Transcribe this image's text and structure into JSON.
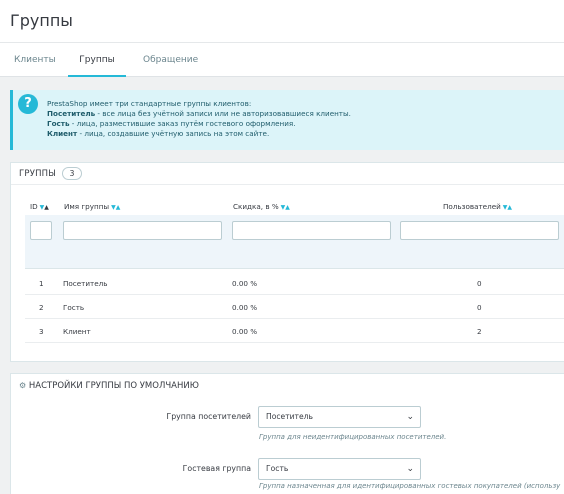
{
  "page": {
    "title": "Группы"
  },
  "tabs": [
    {
      "label": "Клиенты"
    },
    {
      "label": "Группы"
    },
    {
      "label": "Обращение"
    }
  ],
  "alert": {
    "line1": "PrestaShop имеет три стандартные группы клиентов:",
    "items": [
      {
        "name": "Посетитель",
        "text": " - все лица без учётной записи или не авторизовавшиеся клиенты."
      },
      {
        "name": "Гость",
        "text": " - лица, разместившие заказ путём гостевого оформления."
      },
      {
        "name": "Клиент",
        "text": " - лица, создавшие учётную запись на этом сайте."
      }
    ]
  },
  "groups_panel": {
    "title": "ГРУППЫ",
    "count": "3",
    "columns": [
      "ID",
      "Имя группы",
      "Скидка, в %",
      "Пользователей"
    ],
    "rows": [
      {
        "id": "1",
        "name": "Посетитель",
        "discount": "0.00 %",
        "users": "0"
      },
      {
        "id": "2",
        "name": "Гость",
        "discount": "0.00 %",
        "users": "0"
      },
      {
        "id": "3",
        "name": "Клиент",
        "discount": "0.00 %",
        "users": "2"
      }
    ]
  },
  "settings_panel": {
    "title": "НАСТРОЙКИ ГРУППЫ ПО УМОЛЧАНИЮ",
    "fields": [
      {
        "label": "Группа посетителей",
        "value": "Посетитель",
        "help": "Группа для неидентифицированных посетителей."
      },
      {
        "label": "Гостевая группа",
        "value": "Гость",
        "help": "Группа назначенная для идентифицированных гостевых покупателей (использу"
      }
    ]
  },
  "colors": {
    "accent": "#25b9d7",
    "alert_bg": "#dcf4f9",
    "text": "#363a41"
  }
}
